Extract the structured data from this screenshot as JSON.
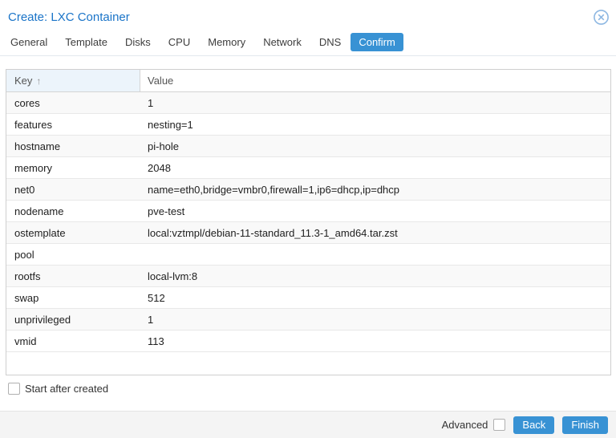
{
  "window": {
    "title": "Create: LXC Container",
    "close_icon": "circle-x"
  },
  "tabs": [
    {
      "label": "General",
      "active": false
    },
    {
      "label": "Template",
      "active": false
    },
    {
      "label": "Disks",
      "active": false
    },
    {
      "label": "CPU",
      "active": false
    },
    {
      "label": "Memory",
      "active": false
    },
    {
      "label": "Network",
      "active": false
    },
    {
      "label": "DNS",
      "active": false
    },
    {
      "label": "Confirm",
      "active": true
    }
  ],
  "table": {
    "columns": [
      {
        "label": "Key",
        "sort_icon": "↑",
        "sorted": "ascending"
      },
      {
        "label": "Value",
        "sort_icon": "",
        "sorted": "none"
      }
    ],
    "rows": [
      {
        "key": "cores",
        "value": "1"
      },
      {
        "key": "features",
        "value": "nesting=1"
      },
      {
        "key": "hostname",
        "value": "pi-hole"
      },
      {
        "key": "memory",
        "value": "2048"
      },
      {
        "key": "net0",
        "value": "name=eth0,bridge=vmbr0,firewall=1,ip6=dhcp,ip=dhcp"
      },
      {
        "key": "nodename",
        "value": "pve-test"
      },
      {
        "key": "ostemplate",
        "value": "local:vztmpl/debian-11-standard_11.3-1_amd64.tar.zst"
      },
      {
        "key": "pool",
        "value": ""
      },
      {
        "key": "rootfs",
        "value": "local-lvm:8"
      },
      {
        "key": "swap",
        "value": "512"
      },
      {
        "key": "unprivileged",
        "value": "1"
      },
      {
        "key": "vmid",
        "value": "113"
      }
    ]
  },
  "options": {
    "start_after_created_label": "Start after created",
    "start_after_created_checked": false
  },
  "footer": {
    "advanced_label": "Advanced",
    "advanced_checked": false,
    "back_label": "Back",
    "finish_label": "Finish"
  },
  "colors": {
    "accent": "#3892d4",
    "title_text": "#1a74c8",
    "sorted_header_bg": "#ecf4fb",
    "row_stripe": "#f9f9f9",
    "footer_bg": "#f4f4f4",
    "grid_border": "#cfcfcf"
  }
}
